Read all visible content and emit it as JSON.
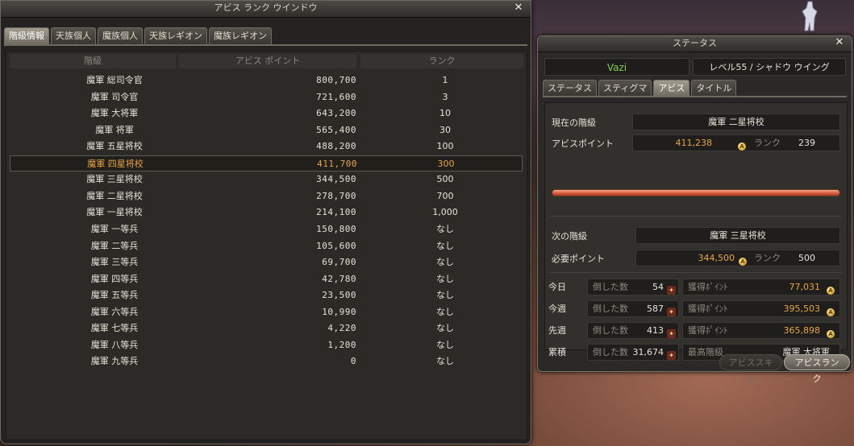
{
  "rank_window": {
    "title": "アビス ランク ウインドウ",
    "tabs": [
      "階級情報",
      "天族個人",
      "魔族個人",
      "天族レギオン",
      "魔族レギオン"
    ],
    "active_tab": 0,
    "columns": [
      "階級",
      "アビス ポイント",
      "ランク"
    ],
    "rows": [
      {
        "grade": "魔軍 総司令官",
        "points": "800,700",
        "rank": "1"
      },
      {
        "grade": "魔軍 司令官",
        "points": "721,600",
        "rank": "3"
      },
      {
        "grade": "魔軍 大将軍",
        "points": "643,200",
        "rank": "10"
      },
      {
        "grade": "魔軍 将軍",
        "points": "565,400",
        "rank": "30"
      },
      {
        "grade": "魔軍 五星将校",
        "points": "488,200",
        "rank": "100"
      },
      {
        "grade": "魔軍 四星将校",
        "points": "411,700",
        "rank": "300"
      },
      {
        "grade": "魔軍 三星将校",
        "points": "344,500",
        "rank": "500"
      },
      {
        "grade": "魔軍 二星将校",
        "points": "278,700",
        "rank": "700"
      },
      {
        "grade": "魔軍 一星将校",
        "points": "214,100",
        "rank": "1,000"
      },
      {
        "grade": "魔軍 一等兵",
        "points": "150,800",
        "rank": "なし"
      },
      {
        "grade": "魔軍 二等兵",
        "points": "105,600",
        "rank": "なし"
      },
      {
        "grade": "魔軍 三等兵",
        "points": "69,700",
        "rank": "なし"
      },
      {
        "grade": "魔軍 四等兵",
        "points": "42,780",
        "rank": "なし"
      },
      {
        "grade": "魔軍 五等兵",
        "points": "23,500",
        "rank": "なし"
      },
      {
        "grade": "魔軍 六等兵",
        "points": "10,990",
        "rank": "なし"
      },
      {
        "grade": "魔軍 七等兵",
        "points": "4,220",
        "rank": "なし"
      },
      {
        "grade": "魔軍 八等兵",
        "points": "1,200",
        "rank": "なし"
      },
      {
        "grade": "魔軍 九等兵",
        "points": "0",
        "rank": "なし"
      }
    ],
    "selected_row": 5,
    "close": "✕"
  },
  "status_window": {
    "title": "ステータス",
    "close": "✕",
    "char_name": "Vazi",
    "level_class": "レベル55 / シャドウ ウイング",
    "tabs": [
      "ステータス",
      "スティグマ",
      "アビス",
      "タイトル"
    ],
    "active_tab": 2,
    "current_grade_label": "現在の階級",
    "current_grade": "魔軍 二星将校",
    "abyss_points_label": "アビスポイント",
    "abyss_points": "411,238",
    "rank_label": "ランク",
    "current_rank": "239",
    "next_grade_label": "次の階級",
    "next_grade": "魔軍 三星将校",
    "required_points_label": "必要ポイント",
    "required_points": "344,500",
    "required_rank": "500",
    "kills_label": "倒した数",
    "gained_label": "獲得ﾎﾟｲﾝﾄ",
    "best_grade_label": "最高階級",
    "stats": [
      {
        "period": "今日",
        "kills": "54",
        "gained": "77,031"
      },
      {
        "period": "今週",
        "kills": "587",
        "gained": "395,503"
      },
      {
        "period": "先週",
        "kills": "413",
        "gained": "365,898"
      }
    ],
    "total_label": "累積",
    "total_kills": "31,674",
    "best_grade": "魔軍 大将軍",
    "progress_fraction": 1.0,
    "btn_skill": "アビススキル",
    "btn_rank": "アビスランク"
  },
  "colors": {
    "highlight": "#e8a443",
    "name": "#7fd34a",
    "progress": "#d5583a"
  }
}
